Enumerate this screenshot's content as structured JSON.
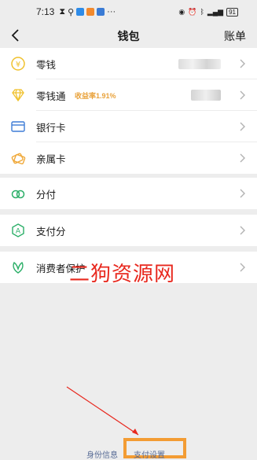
{
  "status_bar": {
    "time": "7:13",
    "battery": "91"
  },
  "nav": {
    "title": "钱包",
    "right_label": "账单"
  },
  "rows": {
    "change": {
      "label": "零钱"
    },
    "lct": {
      "label": "零钱通",
      "yield": "收益率1.91%"
    },
    "bank": {
      "label": "银行卡"
    },
    "family": {
      "label": "亲属卡"
    },
    "installment": {
      "label": "分付"
    },
    "payscore": {
      "label": "支付分"
    },
    "protection": {
      "label": "消费者保护"
    }
  },
  "watermark": "二狗资源网",
  "bottom": {
    "id_info": "身份信息",
    "pay_settings": "支付设置"
  },
  "colors": {
    "yellow": "#f0c12c",
    "blue": "#3d7cd6",
    "green": "#2aae67",
    "orange_highlight": "#f39c34",
    "link": "#576b95"
  }
}
